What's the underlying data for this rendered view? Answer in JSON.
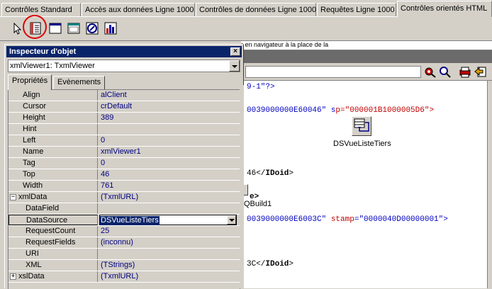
{
  "tabs": [
    {
      "label": "Contrôles Standard"
    },
    {
      "label": "Accès aux données Ligne 1000"
    },
    {
      "label": "Contrôles de données Ligne 1000"
    },
    {
      "label": "Requêtes Ligne 1000"
    },
    {
      "label": "Contrôles orientés HTML"
    }
  ],
  "active_tab": "Contrôles orientés HTML",
  "designer": {
    "hint_text": "r en navigateur à la place de la",
    "xml_lines": [
      {
        "a": "9-1\"?>"
      },
      {
        "a": "0039000000E60046\" s"
      },
      {
        "a": "p=\"000001B1000005D6\">"
      },
      {
        "a": "46</"
      },
      {
        "a": "IDoid"
      },
      {
        "a": ">"
      },
      {
        "a": "e>"
      },
      {
        "a": "0039000000E6003C\" "
      },
      {
        "a": "stamp"
      },
      {
        "a": "=\"0000040D00000001\">"
      },
      {
        "a": "3C</"
      },
      {
        "a": "IDoid"
      },
      {
        "a": ">"
      }
    ],
    "component_dsvue": "DSVueListeTiers",
    "component_qbuild": "QBuild1"
  },
  "inspector": {
    "title": "Inspecteur d'objet",
    "close_label": "×",
    "object_selector": "xmlViewer1: TxmlViewer",
    "tab_properties": "Propriétés",
    "tab_events": "Evènements",
    "rows": [
      {
        "name": "Align",
        "value": "alClient"
      },
      {
        "name": "Cursor",
        "value": "crDefault"
      },
      {
        "name": "Height",
        "value": "389"
      },
      {
        "name": "Hint",
        "value": ""
      },
      {
        "name": "Left",
        "value": "0"
      },
      {
        "name": "Name",
        "value": "xmlViewer1"
      },
      {
        "name": "Tag",
        "value": "0"
      },
      {
        "name": "Top",
        "value": "46"
      },
      {
        "name": "Width",
        "value": "761"
      },
      {
        "name": "xmlData",
        "value": "(TxmlURL)"
      },
      {
        "name": "DataField",
        "value": ""
      },
      {
        "name": "DataSource",
        "value": "DSVueListeTiers"
      },
      {
        "name": "RequestCount",
        "value": "25"
      },
      {
        "name": "RequestFields",
        "value": "(inconnu)"
      },
      {
        "name": "URI",
        "value": ""
      },
      {
        "name": "XML",
        "value": "(TStrings)"
      },
      {
        "name": "xslData",
        "value": "(TxmlURL)"
      }
    ],
    "expand_minus": "−",
    "expand_plus": "+"
  },
  "colors": {
    "titlebar": "#0a246a",
    "value_text": "#000080",
    "highlight_circle": "#e00000",
    "xml_blue": "#0000c0",
    "xml_red": "#c00000"
  }
}
